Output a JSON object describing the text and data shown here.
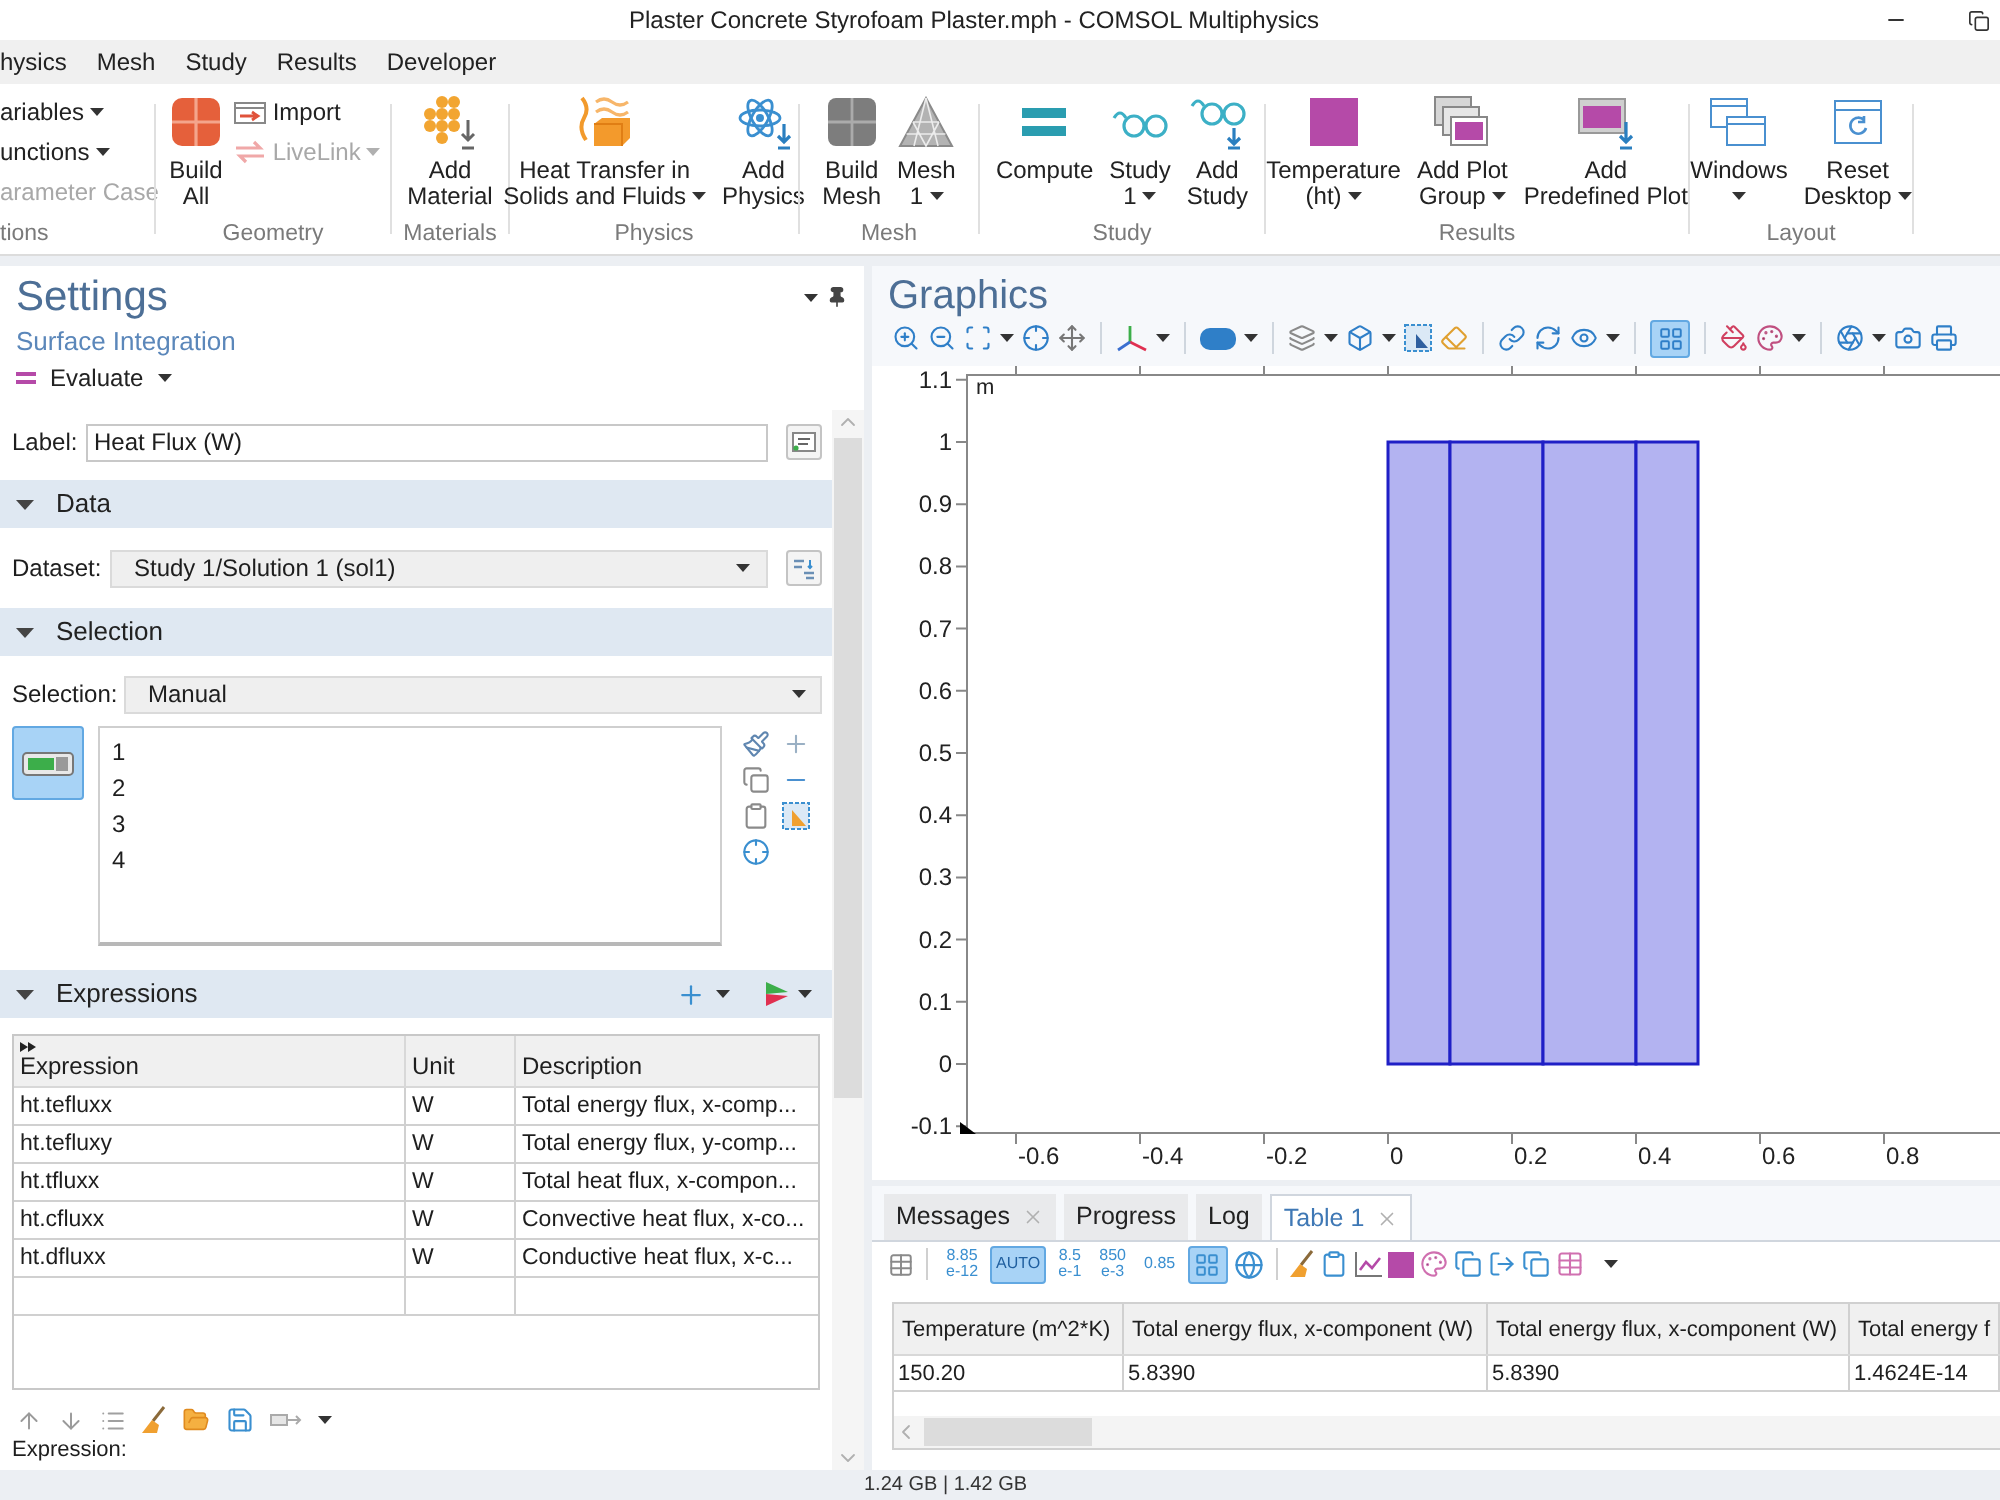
{
  "window": {
    "title": "Plaster Concrete Styrofoam Plaster.mph - COMSOL Multiphysics"
  },
  "menu": [
    {
      "label": "hysics"
    },
    {
      "label": "Mesh"
    },
    {
      "label": "Study"
    },
    {
      "label": "Results"
    },
    {
      "label": "Developer"
    }
  ],
  "ribbon": [
    {
      "label": "tions",
      "buttons": [
        {
          "kind": "small",
          "text": "ariables",
          "dropdown": true,
          "disabled": false
        },
        {
          "kind": "small",
          "text": "unctions",
          "dropdown": true,
          "disabled": false
        },
        {
          "kind": "small",
          "text": "arameter Case",
          "dropdown": false,
          "disabled": true
        }
      ]
    },
    {
      "label": "Geometry",
      "buttons": [
        {
          "kind": "large",
          "lines": [
            "Build",
            "All"
          ],
          "dropdown": false
        },
        {
          "kind": "small",
          "text": "Import",
          "dropdown": false,
          "disabled": false
        },
        {
          "kind": "small",
          "text": "LiveLink",
          "dropdown": true,
          "disabled": true
        }
      ]
    },
    {
      "label": "Materials",
      "buttons": [
        {
          "kind": "large",
          "lines": [
            "Add",
            "Material"
          ],
          "dropdown": false
        }
      ]
    },
    {
      "label": "Physics",
      "buttons": [
        {
          "kind": "large",
          "lines": [
            "Heat Transfer in",
            "Solids and Fluids"
          ],
          "dropdown": true
        },
        {
          "kind": "large",
          "lines": [
            "Add",
            "Physics"
          ],
          "dropdown": false
        }
      ]
    },
    {
      "label": "Mesh",
      "buttons": [
        {
          "kind": "large",
          "lines": [
            "Build",
            "Mesh"
          ],
          "dropdown": false
        },
        {
          "kind": "large",
          "lines": [
            "Mesh",
            "1"
          ],
          "dropdown": true
        }
      ]
    },
    {
      "label": "Study",
      "buttons": [
        {
          "kind": "large",
          "lines": [
            "Compute"
          ],
          "dropdown": false
        },
        {
          "kind": "large",
          "lines": [
            "Study",
            "1"
          ],
          "dropdown": true
        },
        {
          "kind": "large",
          "lines": [
            "Add",
            "Study"
          ],
          "dropdown": false
        }
      ]
    },
    {
      "label": "Results",
      "buttons": [
        {
          "kind": "large",
          "lines": [
            "Temperature",
            "(ht)"
          ],
          "dropdown": true
        },
        {
          "kind": "large",
          "lines": [
            "Add Plot",
            "Group"
          ],
          "dropdown": true
        },
        {
          "kind": "large",
          "lines": [
            "Add",
            "Predefined Plot"
          ],
          "dropdown": false
        }
      ]
    },
    {
      "label": "Layout",
      "buttons": [
        {
          "kind": "large",
          "lines": [
            "Windows"
          ],
          "dropdown": true
        },
        {
          "kind": "large",
          "lines": [
            "Reset",
            "Desktop"
          ],
          "dropdown": true
        }
      ]
    }
  ],
  "settings": {
    "title": "Settings",
    "subtitle": "Surface Integration",
    "evaluate_button": "Evaluate",
    "label_field": {
      "label": "Label:",
      "value": "Heat Flux (W)"
    },
    "data": {
      "heading": "Data",
      "expanded": true,
      "dataset": {
        "label": "Dataset:",
        "value": "Study 1/Solution 1 (sol1)"
      }
    },
    "selection": {
      "heading": "Selection",
      "expanded": true,
      "mode": {
        "label": "Selection:",
        "value": "Manual"
      },
      "active": true,
      "items": [
        "1",
        "2",
        "3",
        "4"
      ]
    },
    "expressions": {
      "heading": "Expressions",
      "expanded": true,
      "columns": [
        "Expression",
        "Unit",
        "Description"
      ],
      "rows": [
        [
          "ht.tefluxx",
          "W",
          "Total energy flux, x-comp..."
        ],
        [
          "ht.tefluxy",
          "W",
          "Total energy flux, y-comp..."
        ],
        [
          "ht.tfluxx",
          "W",
          "Total heat flux, x-compon..."
        ],
        [
          "ht.cfluxx",
          "W",
          "Convective heat flux, x-co..."
        ],
        [
          "ht.dfluxx",
          "W",
          "Conductive heat flux, x-c..."
        ]
      ],
      "field_label": "Expression:"
    }
  },
  "graphics": {
    "title": "Graphics",
    "grid_view_selected": true,
    "axis_unit": "m",
    "yticks": [
      "1.1",
      "1",
      "0.9",
      "0.8",
      "0.7",
      "0.6",
      "0.5",
      "0.4",
      "0.3",
      "0.2",
      "0.1",
      "0",
      "-0.1"
    ],
    "xticks": [
      "-0.6",
      "-0.4",
      "-0.2",
      "0",
      "0.2",
      "0.4",
      "0.6",
      "0.8"
    ]
  },
  "bottom_panel": {
    "tabs": [
      {
        "label": "Messages",
        "closable": true,
        "selected": false
      },
      {
        "label": "Progress",
        "closable": false,
        "selected": false
      },
      {
        "label": "Log",
        "closable": false,
        "selected": false
      },
      {
        "label": "Table 1",
        "closable": true,
        "selected": true
      }
    ],
    "number_formats": [
      {
        "lines": [
          "8.85",
          "e-12"
        ],
        "selected": false
      },
      {
        "lines": [
          "AUTO"
        ],
        "selected": true
      },
      {
        "lines": [
          "8.5",
          "e-1"
        ],
        "selected": false
      },
      {
        "lines": [
          "850",
          "e-3"
        ],
        "selected": false
      },
      {
        "lines": [
          "0.85"
        ],
        "selected": false
      }
    ],
    "grid_view_selected": true,
    "table": {
      "columns": [
        "Temperature (m^2*K)",
        "Total energy flux, x-component (W)",
        "Total energy flux, x-component (W)",
        "Total energy f"
      ],
      "rows": [
        [
          "150.20",
          "5.8390",
          "5.8390",
          "1.4624E-14"
        ]
      ]
    }
  },
  "status_bar": {
    "memory": "1.24 GB | 1.42 GB"
  }
}
